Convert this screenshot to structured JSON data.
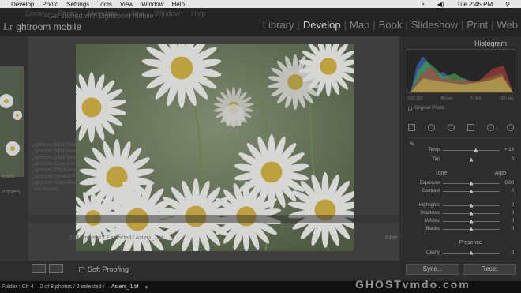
{
  "menubar": {
    "items": [
      "Develop",
      "Photo",
      "Settings",
      "Tools",
      "View",
      "Window",
      "Help"
    ],
    "right": "Tue 2:45 PM"
  },
  "identity": {
    "logo": "Lr",
    "name": "ghtroom mobile",
    "ghost_name": "Get started with Lightroom mobile"
  },
  "ghost_menu": [
    "Library",
    "Photo",
    "Metadata",
    "View",
    "Window",
    "Help"
  ],
  "modules": [
    "Library",
    "Develop",
    "Map",
    "Book",
    "Slideshow",
    "Print",
    "Web"
  ],
  "modules_active": "Develop",
  "left_panel": {
    "presets": "esets",
    "presets2": "Presets",
    "preset_items": [
      "Lightroom B&W Filter Presets",
      "Lightroom B&W Presets",
      "Lightroom B&W Toned Presets",
      "Lightroom Color Presets",
      "Lightroom Effect Presets",
      "Lightroom General Presets",
      "Lightroom Video Presets",
      "User Presets"
    ]
  },
  "center": {
    "breadcrumb": "2 of 8 photos / 2 selected / Asters_1.tif",
    "filter_label": "Filter :"
  },
  "toolbar": {
    "soft_proofing": "Soft Proofing"
  },
  "filmstrip": {
    "folder": "Folder : Ch 4",
    "count": "2 of 8 photos / 2 selected /",
    "filename": "Asters_1.tif",
    "arrow": "▾"
  },
  "right_panel": {
    "histogram_title": "Histogram",
    "exif": [
      "ISO 100",
      "85 mm",
      "f / 4.8",
      "1/60 sec"
    ],
    "original_photo": "Original Photo",
    "sliders": [
      {
        "label": "Temp",
        "value": "+ 16",
        "pos": 0.58
      },
      {
        "label": "Tint",
        "value": "0",
        "pos": 0.5
      },
      {
        "label": "Exposure",
        "value": "0.00",
        "pos": 0.5
      },
      {
        "label": "Contrast",
        "value": "0",
        "pos": 0.5
      },
      {
        "label": "Highlights",
        "value": "0",
        "pos": 0.5
      },
      {
        "label": "Shadows",
        "value": "0",
        "pos": 0.5
      },
      {
        "label": "Whites",
        "value": "0",
        "pos": 0.5
      },
      {
        "label": "Blacks",
        "value": "0",
        "pos": 0.5
      },
      {
        "label": "Clarity",
        "value": "0",
        "pos": 0.5
      }
    ],
    "tone": "Tone",
    "auto": "Auto",
    "presence": "Presence",
    "sync": "Sync...",
    "reset": "Reset"
  },
  "watermark": "GHOSTvmdo.com"
}
